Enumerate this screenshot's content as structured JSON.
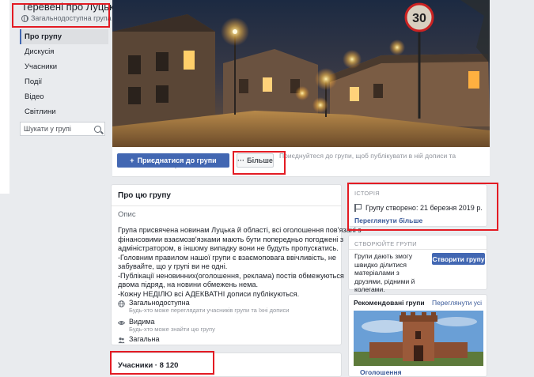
{
  "group": {
    "title": "Теревені про Луцьк",
    "type": "Загальнодоступна група"
  },
  "nav": [
    {
      "label": "Про групу",
      "active": true
    },
    {
      "label": "Дискусія"
    },
    {
      "label": "Учасники"
    },
    {
      "label": "Події"
    },
    {
      "label": "Відео"
    },
    {
      "label": "Світлини"
    }
  ],
  "search": {
    "placeholder": "Шукати у групі"
  },
  "actions": {
    "join_label": "Приєднатися до групи",
    "more_label": "Більше",
    "hint": "Приєднуйтеся до групи, щоб публікувати в ній дописи та залишати коментарі"
  },
  "about": {
    "title": "Про цю групу",
    "section_label": "Опис",
    "description_lines": [
      "Група присвячена новинам Луцька й області, всі оголошення пов'язані з",
      "фінансовими взаємозв'язками мають бути попередньо погоджені з",
      "адміністратором, в іншому випадку вони не будуть пропускатись.",
      "-Головним правилом нашої групи є взаємоповага ввічливість, не",
      "забувайте, що у групі ви не одні.",
      "-Публікації неновинних(оголошення, реклама) постів обмежуються",
      "двома підряд, на новини обмежень нема.",
      "-Кожну НЕДІЛЮ всі АДЕКВАТНІ дописи публікуються."
    ],
    "privacy": [
      {
        "title": "Загальнодоступна",
        "subtitle": "Будь-хто може переглядати учасників групи та їхні дописи"
      },
      {
        "title": "Видима",
        "subtitle": "Будь-хто може знайти цю групу"
      },
      {
        "title": "Загальна",
        "subtitle": ""
      }
    ]
  },
  "members": {
    "title": "Учасники · 8 120"
  },
  "history": {
    "label": "ІСТОРІЯ",
    "created": "Групу створено: 21 березня 2019 р.",
    "link": "Переглянути більше"
  },
  "create_group": {
    "label": "СТВОРЮЙТЕ ГРУПИ",
    "text": "Групи дають змогу швидко ділитися матеріалами з друзями, рідними й колегами.",
    "button": "Створити групу"
  },
  "recommended": {
    "title": "Рекомендовані групи",
    "more": "Переглянути усі",
    "item_name": "Оголошення"
  },
  "colors": {
    "accent": "#4267b2",
    "link": "#385898",
    "highlight": "#e31b23"
  }
}
